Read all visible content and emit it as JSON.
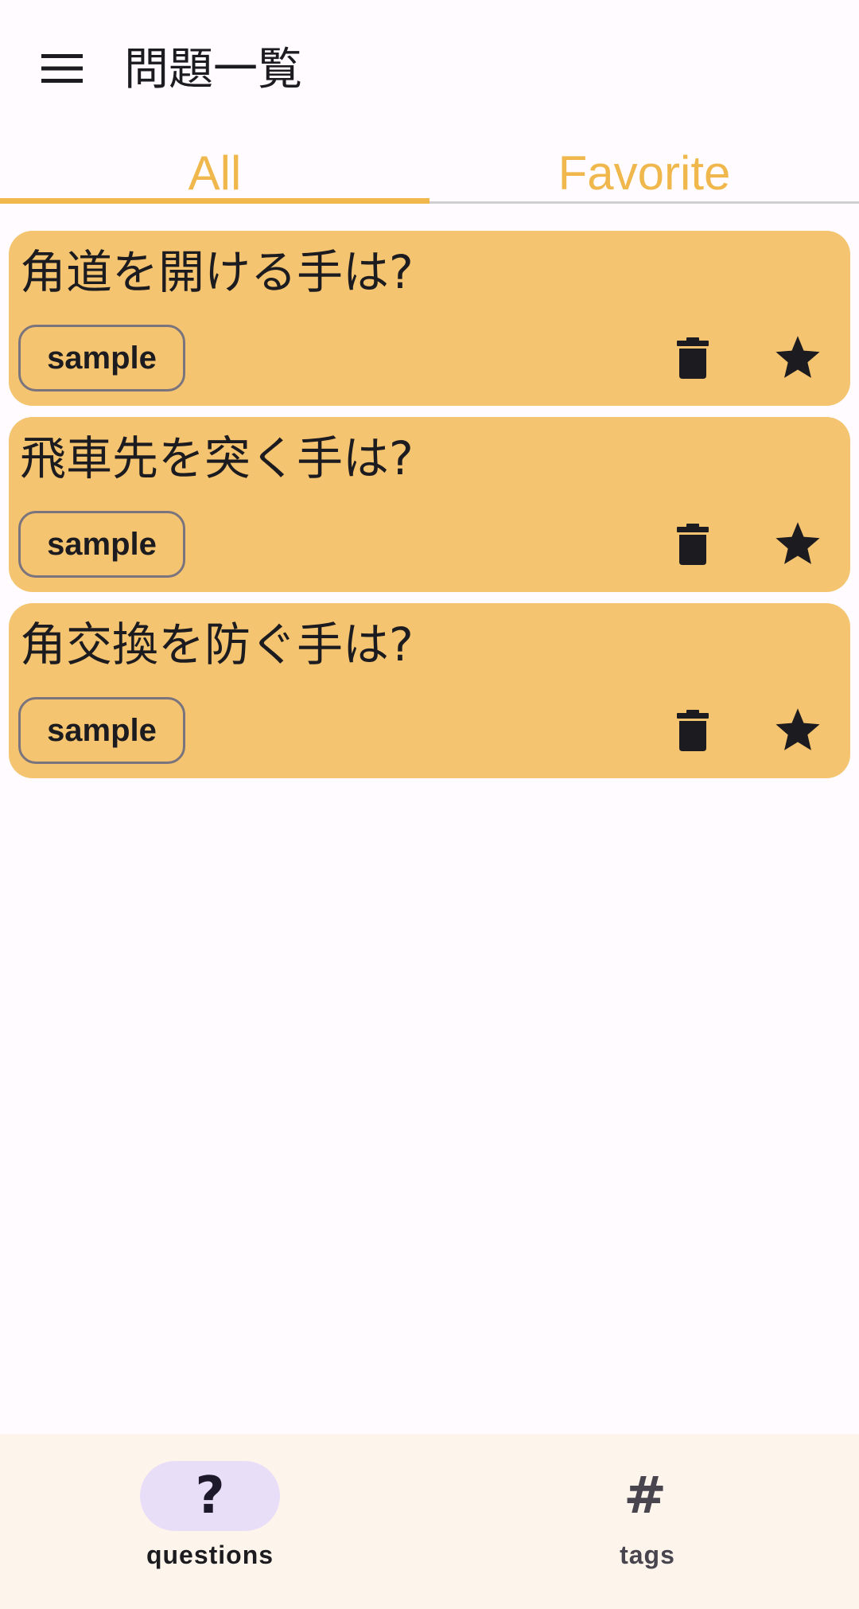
{
  "header": {
    "title": "問題一覧",
    "menu_icon": "menu-icon"
  },
  "tabs": [
    {
      "label": "All",
      "selected": true
    },
    {
      "label": "Favorite",
      "selected": false
    }
  ],
  "questions": [
    {
      "text": "角道を開ける手は?",
      "tag": "sample",
      "favorite": true
    },
    {
      "text": "飛車先を突く手は?",
      "tag": "sample",
      "favorite": true
    },
    {
      "text": "角交換を防ぐ手は?",
      "tag": "sample",
      "favorite": true
    }
  ],
  "bottom_nav": {
    "items": [
      {
        "label": "questions",
        "icon": "question-mark-icon",
        "glyph": "?",
        "selected": true
      },
      {
        "label": "tags",
        "icon": "hash-icon",
        "glyph": "#",
        "selected": false
      }
    ]
  },
  "colors": {
    "accent": "#f0b84c",
    "card": "#f4c470",
    "nav_active_pill": "#e8def8",
    "background": "#fffbfe",
    "nav_background": "#fdf5ec"
  }
}
